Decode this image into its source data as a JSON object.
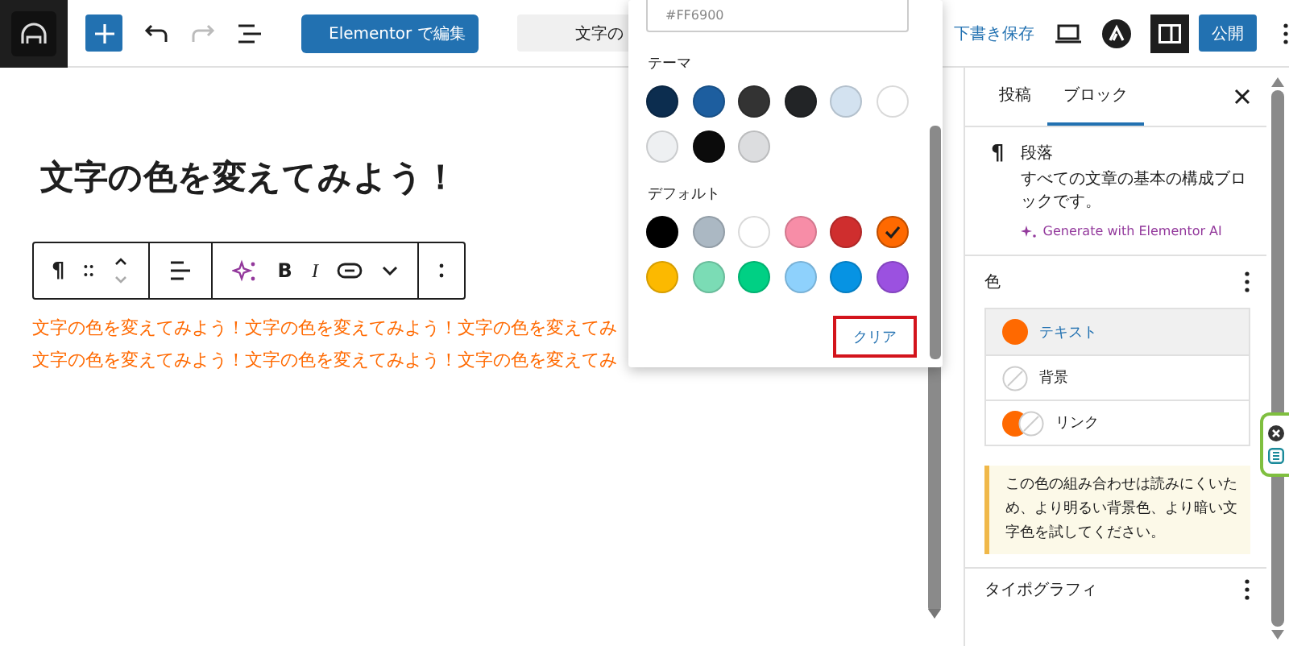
{
  "top_bar": {
    "elementor_button": "Elementor で編集",
    "document_title": "文字の",
    "save_draft": "下書き保存",
    "settings_toggle": {
      "on": true
    },
    "publish": "公開"
  },
  "editor": {
    "heading": "文字の色を変えてみよう！",
    "block_toolbar": {
      "block_icon": "¶",
      "bold": "B",
      "italic": "I"
    },
    "paragraph_lines": [
      "文字の色を変えてみよう！文字の色を変えてみよう！文字の色を変えてみ",
      "文字の色を変えてみよう！文字の色を変えてみよう！文字の色を変えてみ"
    ]
  },
  "color_popover": {
    "hex_value": "#FF6900",
    "groups": [
      {
        "label": "テーマ",
        "swatches": [
          {
            "color": "#0c2d4f",
            "selected": false
          },
          {
            "color": "#1d5e9f",
            "selected": false
          },
          {
            "color": "#333333",
            "selected": false
          },
          {
            "color": "#222426",
            "selected": false
          },
          {
            "color": "#d3e2f0",
            "selected": false
          },
          {
            "color": "#ffffff",
            "selected": false
          },
          {
            "color": "#eef0f2",
            "selected": false
          },
          {
            "color": "#0b0b0b",
            "selected": false
          },
          {
            "color": "#dcdddf",
            "selected": false
          }
        ]
      },
      {
        "label": "デフォルト",
        "swatches": [
          {
            "color": "#000000",
            "selected": false
          },
          {
            "color": "#abb8c3",
            "selected": false
          },
          {
            "color": "#ffffff",
            "selected": false
          },
          {
            "color": "#f78da7",
            "selected": false
          },
          {
            "color": "#cf2e2e",
            "selected": false
          },
          {
            "color": "#ff6900",
            "selected": true
          },
          {
            "color": "#fcb900",
            "selected": false
          },
          {
            "color": "#7bdcb5",
            "selected": false
          },
          {
            "color": "#00d084",
            "selected": false
          },
          {
            "color": "#8ed1fc",
            "selected": false
          },
          {
            "color": "#0693e3",
            "selected": false
          },
          {
            "color": "#9b51e0",
            "selected": false
          }
        ]
      }
    ],
    "clear_button": "クリア"
  },
  "sidebar": {
    "tabs": [
      {
        "label": "投稿",
        "selected": false
      },
      {
        "label": "ブロック",
        "selected": true
      }
    ],
    "block": {
      "icon": "¶",
      "name": "段落",
      "description": "すべての文章の基本の構成ブロックです。",
      "ai_link": "Generate with Elementor AI"
    },
    "color_panel": {
      "title": "色",
      "items": [
        {
          "label": "テキスト",
          "selected": true,
          "swatches": [
            {
              "kind": "color",
              "color": "#ff6900"
            }
          ]
        },
        {
          "label": "背景",
          "selected": false,
          "swatches": [
            {
              "kind": "none"
            }
          ]
        },
        {
          "label": "リンク",
          "selected": false,
          "swatches": [
            {
              "kind": "color",
              "color": "#ff6900"
            },
            {
              "kind": "none"
            }
          ]
        }
      ]
    },
    "notice": "この色の組み合わせは読みにくいため、より明るい背景色、より暗い文字色を試してください。",
    "typography": {
      "title": "タイポグラフィ"
    }
  }
}
